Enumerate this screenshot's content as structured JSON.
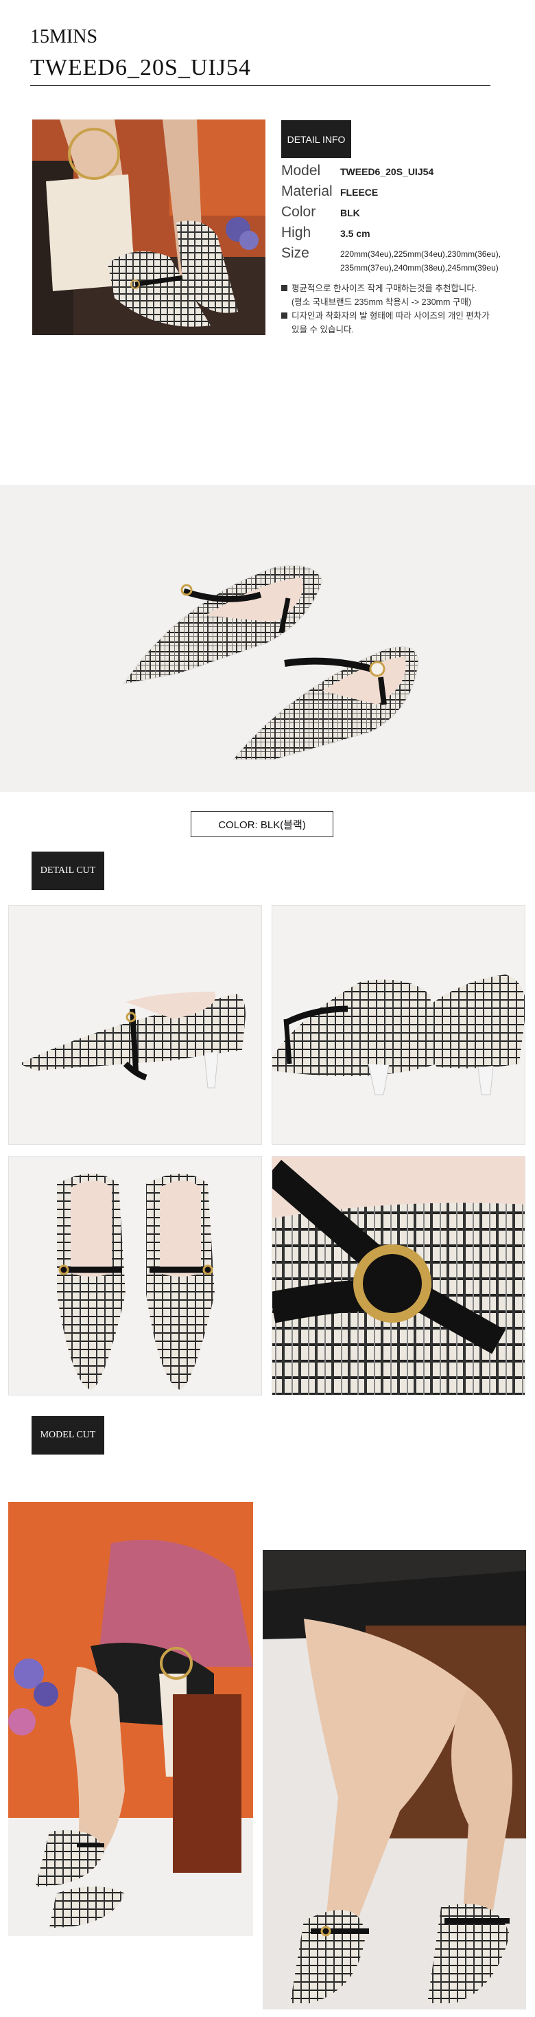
{
  "header": {
    "brand": "15MINS",
    "product_code": "TWEED6_20S_UIJ54"
  },
  "detail_info": {
    "badge": "DETAIL INFO",
    "specs": [
      {
        "label": "Model",
        "value": "TWEED6_20S_UIJ54"
      },
      {
        "label": "Material",
        "value": "FLEECE"
      },
      {
        "label": "Color",
        "value": "BLK"
      },
      {
        "label": "High",
        "value": "3.5 cm"
      },
      {
        "label": "Size",
        "value": ""
      }
    ],
    "size_line1": "220mm(34eu),225mm(34eu),230mm(36eu),",
    "size_line2": "235mm(37eu),240mm(38eu),245mm(39eu)",
    "note1_line1": "평균적으로 한사이즈 작게 구매하는것을 추천합니다.",
    "note1_line2": "(평소 국내브랜드 235mm 착용시 -> 230mm 구매)",
    "note2_line1": "디자인과 착화자의 발 형태에 따라 사이즈의 개인 편차가",
    "note2_line2": "있을 수 있습니다."
  },
  "color_label": "COLOR:  BLK(블랙)",
  "detail_cut": {
    "badge": "DETAIL CUT"
  },
  "model_cut": {
    "badge": "MODEL CUT"
  },
  "colors": {
    "badge_bg": "#1e1e1e",
    "tweed_light": "#ece8e0",
    "tweed_dark": "#1f1f1f",
    "strap": "#111111",
    "lining": "#f1dcd2",
    "orange_bg": "#e0662f",
    "sweater": "#c1607a"
  }
}
